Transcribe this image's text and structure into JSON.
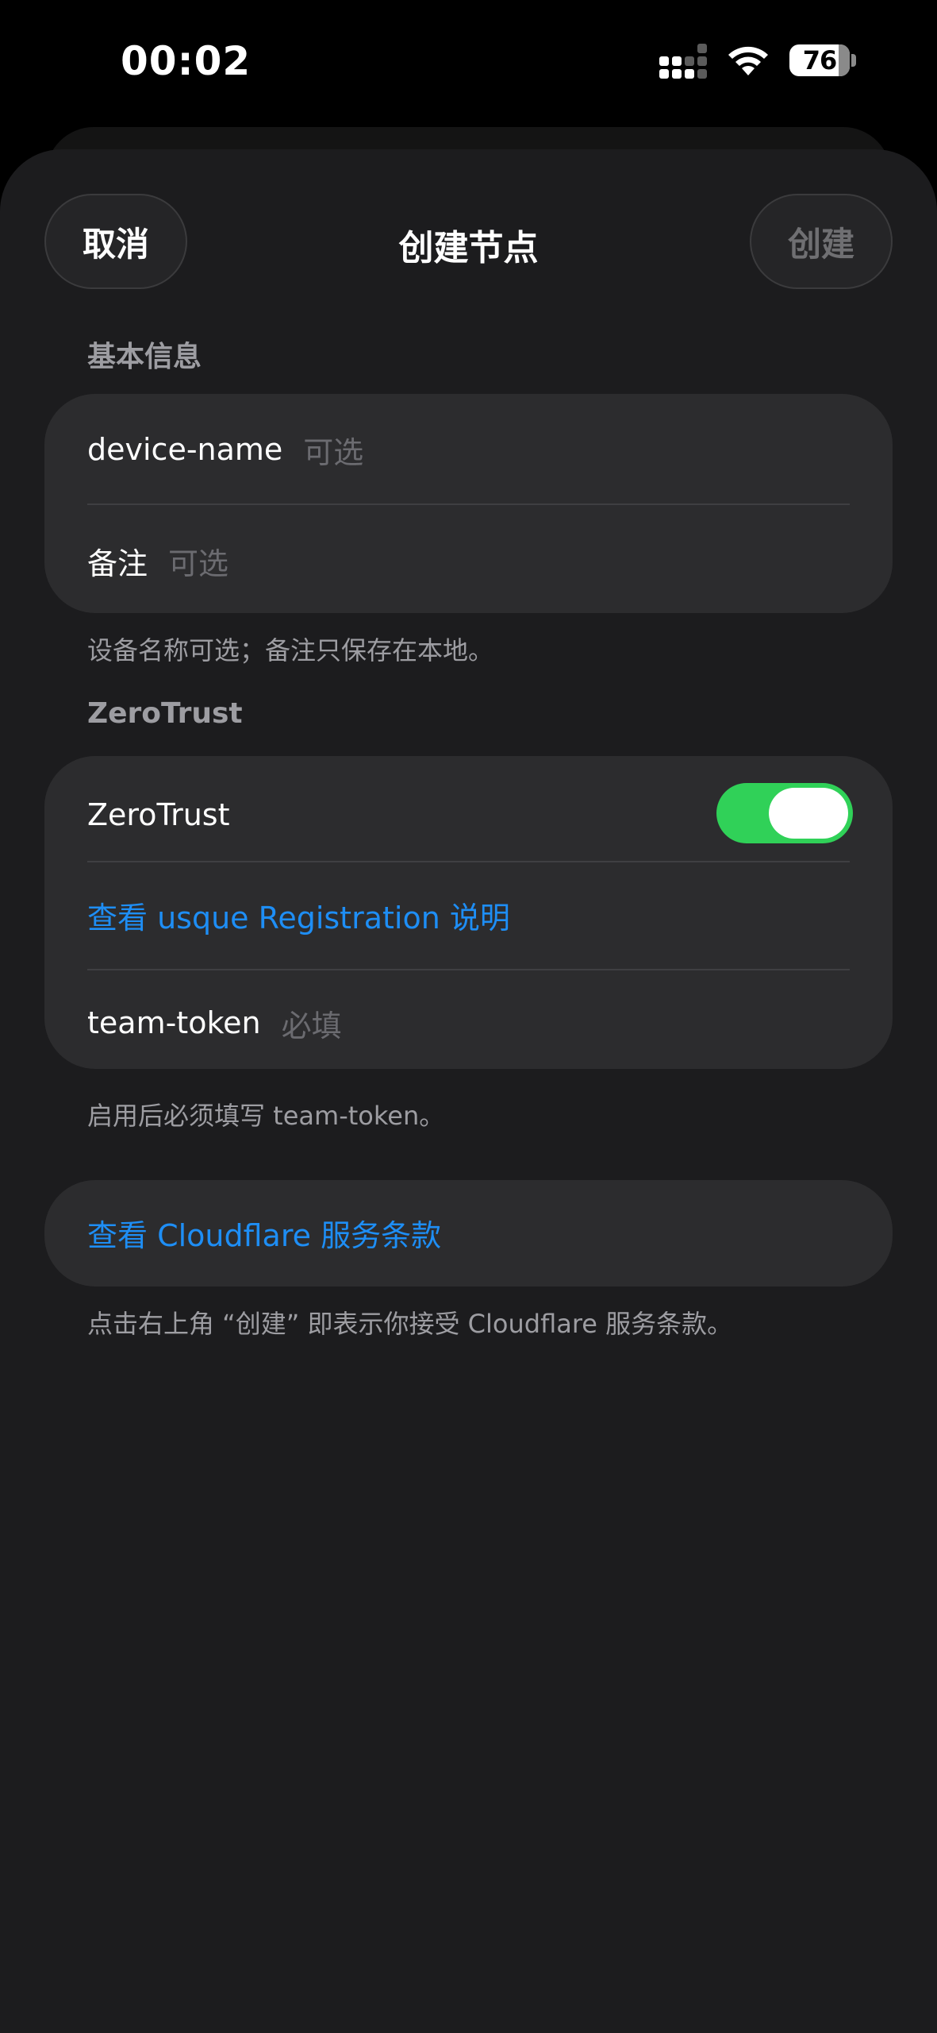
{
  "status_bar": {
    "time": "00:02",
    "battery_level": "76",
    "icons": [
      "cellular-signal-icon",
      "wifi-icon",
      "battery-icon"
    ]
  },
  "header": {
    "cancel_label": "取消",
    "title": "创建节点",
    "create_label": "创建"
  },
  "basic_info": {
    "section_label": "基本信息",
    "device_name_label": "device-name",
    "device_name_placeholder": "可选",
    "note_label": "备注",
    "note_placeholder": "可选",
    "footnote": "设备名称可选；备注只保存在本地。"
  },
  "zerotrust": {
    "section_label": "ZeroTrust",
    "toggle_label": "ZeroTrust",
    "toggle_on": true,
    "registration_link": "查看 usque Registration 说明",
    "team_token_label": "team-token",
    "team_token_placeholder": "必填",
    "footnote": "启用后必须填写 team-token。"
  },
  "terms": {
    "link_label": "查看 Cloudflare 服务条款",
    "footnote": "点击右上角 “创建” 即表示你接受 Cloudflare 服务条款。"
  },
  "colors": {
    "background": "#1c1c1e",
    "card": "#2c2c2e",
    "link": "#1e8ef5",
    "toggle_on": "#30d158",
    "secondary_text": "#9d9da2"
  }
}
